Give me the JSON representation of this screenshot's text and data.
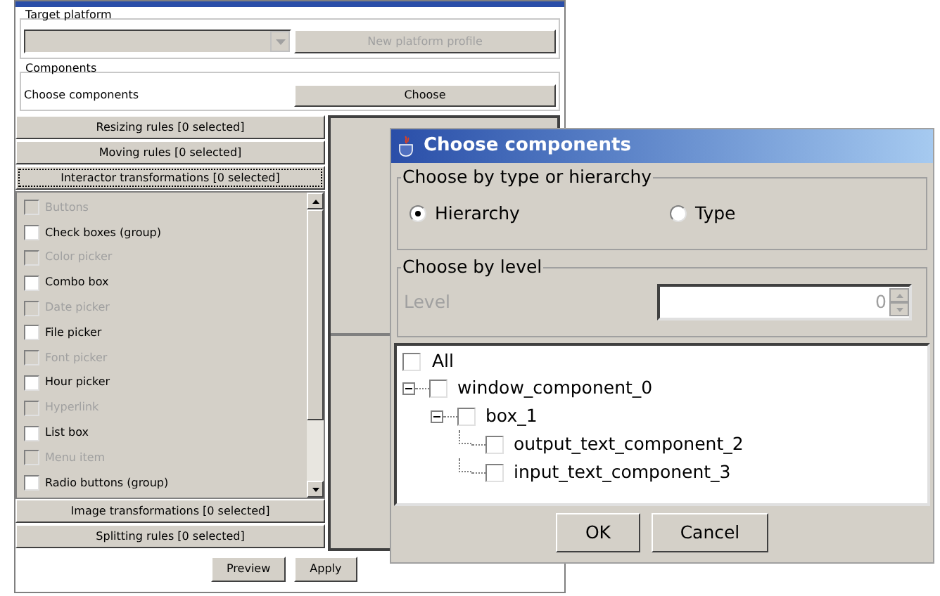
{
  "target_platform": {
    "title": "Target platform",
    "platform_select": {
      "disabled": true
    },
    "new_profile_button": {
      "label": "New platform profile",
      "disabled": true
    }
  },
  "components": {
    "title": "Components",
    "label": "Choose components",
    "button": "Choose"
  },
  "rule_sections": [
    {
      "label": "Resizing rules [0 selected]",
      "expanded": false
    },
    {
      "label": "Moving rules [0 selected]",
      "expanded": false
    },
    {
      "label": "Interactor transformations [0 selected]",
      "expanded": true
    },
    {
      "label": "Image transformations [0 selected]",
      "expanded": false
    },
    {
      "label": "Splitting rules [0 selected]",
      "expanded": false
    }
  ],
  "interactor_items": [
    {
      "label": "Buttons",
      "disabled": true,
      "checked": false
    },
    {
      "label": "Check boxes (group)",
      "disabled": false,
      "checked": false
    },
    {
      "label": "Color picker",
      "disabled": true,
      "checked": false
    },
    {
      "label": "Combo box",
      "disabled": false,
      "checked": false
    },
    {
      "label": "Date picker",
      "disabled": true,
      "checked": false
    },
    {
      "label": "File picker",
      "disabled": false,
      "checked": false
    },
    {
      "label": "Font picker",
      "disabled": true,
      "checked": false
    },
    {
      "label": "Hour picker",
      "disabled": false,
      "checked": false
    },
    {
      "label": "Hyperlink",
      "disabled": true,
      "checked": false
    },
    {
      "label": "List box",
      "disabled": false,
      "checked": false
    },
    {
      "label": "Menu item",
      "disabled": true,
      "checked": false
    },
    {
      "label": "Radio buttons (group)",
      "disabled": false,
      "checked": false
    }
  ],
  "buttons": [
    "Preview",
    "Apply"
  ],
  "dialog": {
    "title": "Choose components",
    "type_group": {
      "title": "Choose by type or hierarchy",
      "options": [
        {
          "label": "Hierarchy",
          "selected": true
        },
        {
          "label": "Type",
          "selected": false
        }
      ]
    },
    "level_group": {
      "title": "Choose by level",
      "label": "Level",
      "value": "0",
      "disabled": true
    },
    "all": {
      "label": "All",
      "checked": false
    },
    "tree": [
      {
        "label": "window_component_0",
        "checked": false,
        "expanded": true,
        "children": [
          {
            "label": "box_1",
            "checked": false,
            "expanded": true,
            "children": [
              {
                "label": "output_text_component_2",
                "checked": false
              },
              {
                "label": "input_text_component_3",
                "checked": false
              }
            ]
          }
        ]
      }
    ],
    "buttons": [
      "OK",
      "Cancel"
    ]
  }
}
